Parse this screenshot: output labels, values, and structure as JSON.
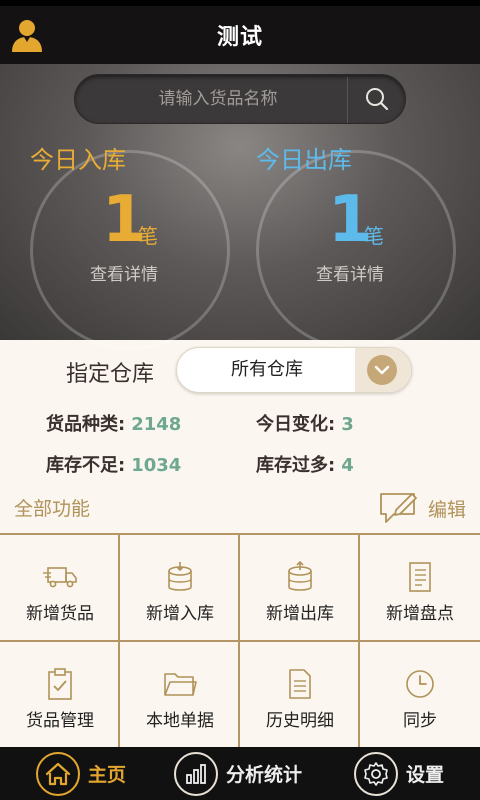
{
  "header": {
    "title": "测试",
    "avatar_icon": "user-avatar-icon"
  },
  "search": {
    "placeholder": "请输入货品名称",
    "icon": "search-icon"
  },
  "today_in": {
    "label": "今日入库",
    "count": "1",
    "unit": "笔",
    "detail": "查看详情",
    "color": "#e8ac35"
  },
  "today_out": {
    "label": "今日出库",
    "count": "1",
    "unit": "笔",
    "detail": "查看详情",
    "color": "#5dbbec"
  },
  "warehouse": {
    "label": "指定仓库",
    "selected": "所有仓库"
  },
  "stats": {
    "types_label": "货品种类:",
    "types_value": "2148",
    "change_label": "今日变化:",
    "change_value": "3",
    "low_label": "库存不足:",
    "low_value": "1034",
    "over_label": "库存过多:",
    "over_value": "4"
  },
  "functions": {
    "title": "全部功能",
    "edit_label": "编辑",
    "items": [
      {
        "label": "新增货品",
        "icon": "truck-icon"
      },
      {
        "label": "新增入库",
        "icon": "storage-in-icon"
      },
      {
        "label": "新增出库",
        "icon": "storage-out-icon"
      },
      {
        "label": "新增盘点",
        "icon": "checklist-icon"
      },
      {
        "label": "货品管理",
        "icon": "clipboard-check-icon"
      },
      {
        "label": "本地单据",
        "icon": "folder-icon"
      },
      {
        "label": "历史明细",
        "icon": "document-icon"
      },
      {
        "label": "同步",
        "icon": "clock-icon"
      }
    ]
  },
  "nav": {
    "home": "主页",
    "stats": "分析统计",
    "settings": "设置"
  },
  "colors": {
    "accent_gold": "#b0935a",
    "value_green": "#6ea890",
    "active_nav": "#e3a72f"
  }
}
